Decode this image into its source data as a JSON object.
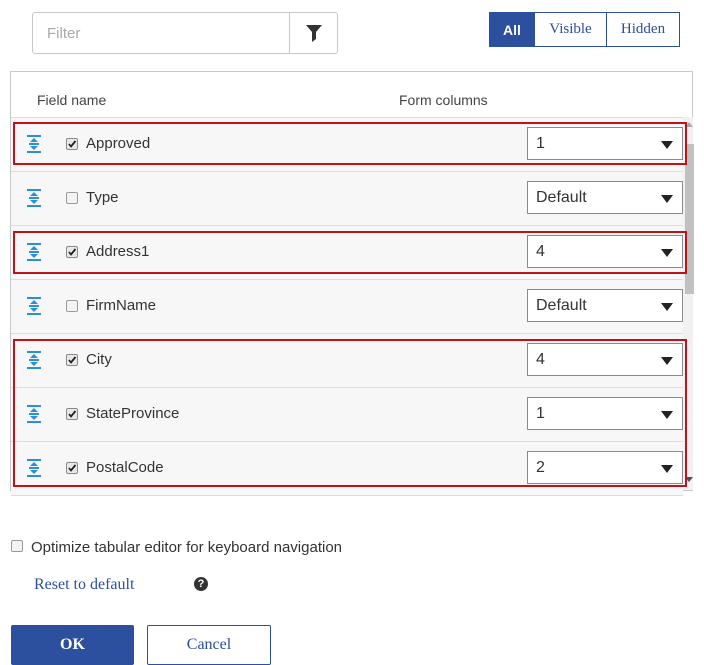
{
  "filter": {
    "placeholder": "Filter",
    "icon": "funnel-icon"
  },
  "view_toggle": {
    "options": [
      "All",
      "Visible",
      "Hidden"
    ],
    "selected": "All"
  },
  "grid": {
    "headers": {
      "field_name": "Field name",
      "form_columns": "Form columns"
    },
    "rows": [
      {
        "label": "Approved",
        "checked": true,
        "columns": "1",
        "highlighted": true
      },
      {
        "label": "Type",
        "checked": false,
        "columns": "Default",
        "highlighted": false
      },
      {
        "label": "Address1",
        "checked": true,
        "columns": "4",
        "highlighted": true
      },
      {
        "label": "FirmName",
        "checked": false,
        "columns": "Default",
        "highlighted": false
      },
      {
        "label": "City",
        "checked": true,
        "columns": "4",
        "highlighted": true
      },
      {
        "label": "StateProvince",
        "checked": true,
        "columns": "1",
        "highlighted": true
      },
      {
        "label": "PostalCode",
        "checked": true,
        "columns": "2",
        "highlighted": true
      }
    ]
  },
  "options": {
    "keyboard_nav_label": "Optimize tabular editor for keyboard navigation",
    "keyboard_nav_checked": false
  },
  "reset_link": "Reset to default",
  "help_icon": "?",
  "buttons": {
    "ok": "OK",
    "cancel": "Cancel"
  },
  "colors": {
    "accent": "#2c4f9e",
    "highlight_border": "#c0121b",
    "drag_icon": "#2b8fd6"
  }
}
